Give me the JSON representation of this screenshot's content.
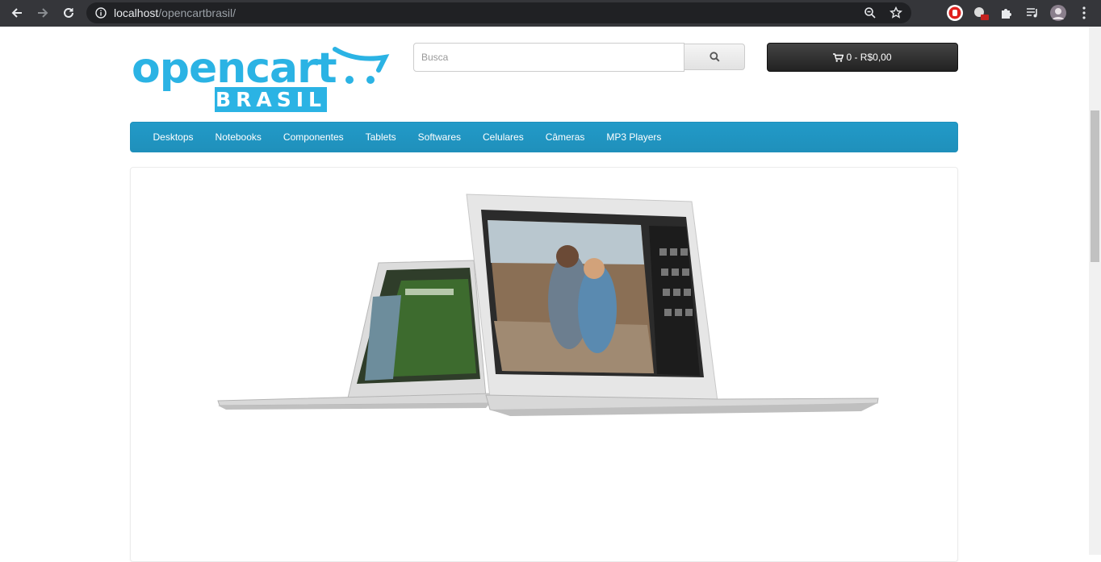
{
  "browser": {
    "url_host": "localhost",
    "url_path": "/opencartbrasil/"
  },
  "header": {
    "logo_word": "opencart",
    "logo_sub": "BRASIL",
    "search_placeholder": "Busca",
    "cart_label": "0 - R$0,00"
  },
  "menu": {
    "items": [
      "Desktops",
      "Notebooks",
      "Componentes",
      "Tablets",
      "Softwares",
      "Celulares",
      "Câmeras",
      "MP3 Players"
    ]
  },
  "colors": {
    "brand": "#2bb3e4",
    "menu": "#229ac8",
    "cart": "#333333"
  }
}
